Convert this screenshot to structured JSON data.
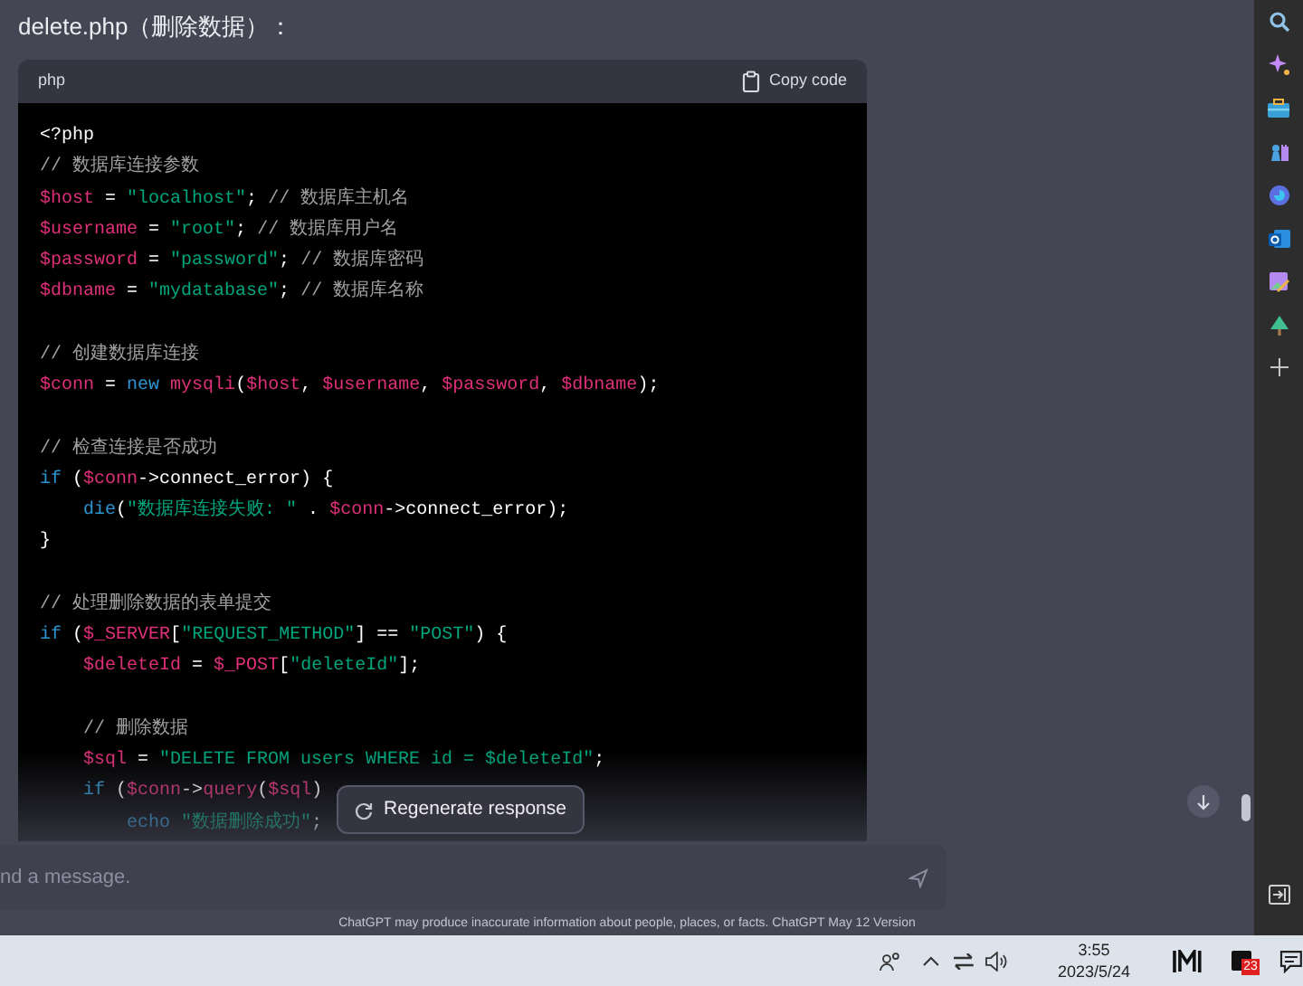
{
  "intro": "delete.php（删除数据）：",
  "code_block": {
    "language": "php",
    "copy_label": "Copy code",
    "lines": [
      {
        "kind": "code",
        "tokens": [
          {
            "kind": "plain",
            "text": "<?php"
          }
        ]
      },
      {
        "kind": "code",
        "tokens": [
          {
            "kind": "comment",
            "text": "// 数据库连接参数"
          }
        ]
      },
      {
        "kind": "code",
        "tokens": [
          {
            "kind": "var",
            "text": "$host"
          },
          {
            "kind": "plain",
            "text": " = "
          },
          {
            "kind": "str",
            "text": "\"localhost\""
          },
          {
            "kind": "plain",
            "text": "; "
          },
          {
            "kind": "comment",
            "text": "// 数据库主机名"
          }
        ]
      },
      {
        "kind": "code",
        "tokens": [
          {
            "kind": "var",
            "text": "$username"
          },
          {
            "kind": "plain",
            "text": " = "
          },
          {
            "kind": "str",
            "text": "\"root\""
          },
          {
            "kind": "plain",
            "text": "; "
          },
          {
            "kind": "comment",
            "text": "// 数据库用户名"
          }
        ]
      },
      {
        "kind": "code",
        "tokens": [
          {
            "kind": "var",
            "text": "$password"
          },
          {
            "kind": "plain",
            "text": " = "
          },
          {
            "kind": "str",
            "text": "\"password\""
          },
          {
            "kind": "plain",
            "text": "; "
          },
          {
            "kind": "comment",
            "text": "// 数据库密码"
          }
        ]
      },
      {
        "kind": "code",
        "tokens": [
          {
            "kind": "var",
            "text": "$dbname"
          },
          {
            "kind": "plain",
            "text": " = "
          },
          {
            "kind": "str",
            "text": "\"mydatabase\""
          },
          {
            "kind": "plain",
            "text": "; "
          },
          {
            "kind": "comment",
            "text": "// 数据库名称"
          }
        ]
      },
      {
        "kind": "blank"
      },
      {
        "kind": "code",
        "tokens": [
          {
            "kind": "comment",
            "text": "// 创建数据库连接"
          }
        ]
      },
      {
        "kind": "code",
        "tokens": [
          {
            "kind": "var",
            "text": "$conn"
          },
          {
            "kind": "plain",
            "text": " = "
          },
          {
            "kind": "kw",
            "text": "new "
          },
          {
            "kind": "var",
            "text": "mysqli"
          },
          {
            "kind": "plain",
            "text": "("
          },
          {
            "kind": "var",
            "text": "$host"
          },
          {
            "kind": "plain",
            "text": ", "
          },
          {
            "kind": "var",
            "text": "$username"
          },
          {
            "kind": "plain",
            "text": ", "
          },
          {
            "kind": "var",
            "text": "$password"
          },
          {
            "kind": "plain",
            "text": ", "
          },
          {
            "kind": "var",
            "text": "$dbname"
          },
          {
            "kind": "plain",
            "text": ");"
          }
        ]
      },
      {
        "kind": "blank"
      },
      {
        "kind": "code",
        "tokens": [
          {
            "kind": "comment",
            "text": "// 检查连接是否成功"
          }
        ]
      },
      {
        "kind": "code",
        "tokens": [
          {
            "kind": "kw",
            "text": "if"
          },
          {
            "kind": "plain",
            "text": " ("
          },
          {
            "kind": "var",
            "text": "$conn"
          },
          {
            "kind": "plain",
            "text": "->connect_error) {"
          }
        ]
      },
      {
        "kind": "code",
        "tokens": [
          {
            "kind": "kw",
            "text": "    die"
          },
          {
            "kind": "plain",
            "text": "("
          },
          {
            "kind": "str",
            "text": "\"数据库连接失败: \""
          },
          {
            "kind": "plain",
            "text": " . "
          },
          {
            "kind": "var",
            "text": "$conn"
          },
          {
            "kind": "plain",
            "text": "->connect_error);"
          }
        ]
      },
      {
        "kind": "code",
        "tokens": [
          {
            "kind": "plain",
            "text": "}"
          }
        ]
      },
      {
        "kind": "blank"
      },
      {
        "kind": "code",
        "tokens": [
          {
            "kind": "comment",
            "text": "// 处理删除数据的表单提交"
          }
        ]
      },
      {
        "kind": "code",
        "tokens": [
          {
            "kind": "kw",
            "text": "if"
          },
          {
            "kind": "plain",
            "text": " ("
          },
          {
            "kind": "var",
            "text": "$_SERVER"
          },
          {
            "kind": "plain",
            "text": "["
          },
          {
            "kind": "str",
            "text": "\"REQUEST_METHOD\""
          },
          {
            "kind": "plain",
            "text": "] == "
          },
          {
            "kind": "str",
            "text": "\"POST\""
          },
          {
            "kind": "plain",
            "text": ") {"
          }
        ]
      },
      {
        "kind": "code",
        "tokens": [
          {
            "kind": "var",
            "text": "    $deleteId"
          },
          {
            "kind": "plain",
            "text": " = "
          },
          {
            "kind": "var",
            "text": "$_POST"
          },
          {
            "kind": "plain",
            "text": "["
          },
          {
            "kind": "str",
            "text": "\"deleteId\""
          },
          {
            "kind": "plain",
            "text": "];"
          }
        ]
      },
      {
        "kind": "blank"
      },
      {
        "kind": "code",
        "tokens": [
          {
            "kind": "comment",
            "text": "    // 删除数据"
          }
        ]
      },
      {
        "kind": "code",
        "tokens": [
          {
            "kind": "var",
            "text": "    $sql"
          },
          {
            "kind": "plain",
            "text": " = "
          },
          {
            "kind": "str",
            "text": "\"DELETE FROM users WHERE id = $deleteId\""
          },
          {
            "kind": "plain",
            "text": ";"
          }
        ]
      },
      {
        "kind": "code",
        "tokens": [
          {
            "kind": "kw",
            "text": "    if"
          },
          {
            "kind": "plain",
            "text": " ("
          },
          {
            "kind": "var",
            "text": "$conn"
          },
          {
            "kind": "plain",
            "text": "->"
          },
          {
            "kind": "var",
            "text": "query"
          },
          {
            "kind": "plain",
            "text": "("
          },
          {
            "kind": "var",
            "text": "$sql"
          },
          {
            "kind": "plain",
            "text": ")"
          }
        ]
      },
      {
        "kind": "code",
        "tokens": [
          {
            "kind": "kw",
            "text": "        echo "
          },
          {
            "kind": "str",
            "text": "\"数据删除成功\""
          },
          {
            "kind": "plain",
            "text": ";"
          }
        ]
      }
    ]
  },
  "regenerate_button": "Regenerate response",
  "message_input": {
    "placeholder": "nd a message."
  },
  "disclaimer": "ChatGPT may produce inaccurate information about people, places, or facts. ChatGPT May 12 Version",
  "taskbar": {
    "time": "3:55",
    "date": "2023/5/24",
    "badge": "23"
  }
}
